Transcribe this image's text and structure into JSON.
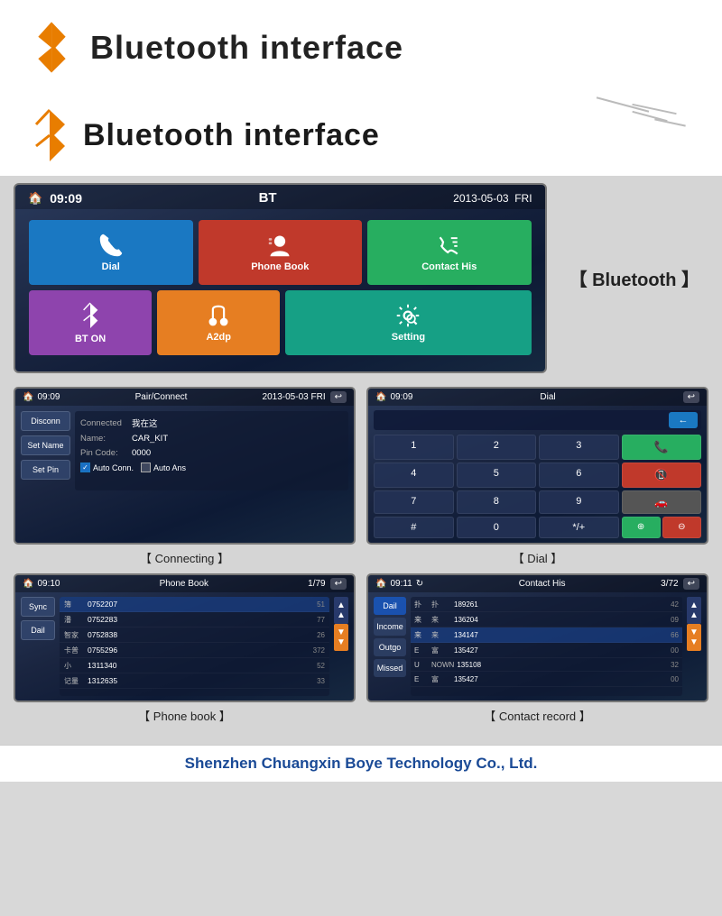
{
  "header": {
    "title": "Bluetooth interface",
    "bt_icon_color": "#e87d00"
  },
  "main_screen": {
    "status": {
      "time": "09:09",
      "center": "BT",
      "date": "2013-05-03",
      "day": "FRI"
    },
    "tiles": [
      {
        "id": "dial",
        "label": "Dial",
        "icon": "📞",
        "color": "#1a78c2"
      },
      {
        "id": "phonebook",
        "label": "Phone Book",
        "icon": "👤",
        "color": "#c0392b"
      },
      {
        "id": "contacthis",
        "label": "Contact His",
        "icon": "📋",
        "color": "#27ae60"
      },
      {
        "id": "bton",
        "label": "BT ON",
        "icon": "🔵",
        "color": "#8e44ad"
      },
      {
        "id": "a2dp",
        "label": "A2dp",
        "icon": "🎧",
        "color": "#e67e22"
      },
      {
        "id": "setting",
        "label": "Setting",
        "icon": "⚙",
        "color": "#16a085"
      }
    ]
  },
  "connecting_screen": {
    "status": {
      "time": "09:09",
      "center": "Pair/Connect",
      "date": "2013-05-03",
      "day": "FRI"
    },
    "buttons": [
      "Disconn",
      "Set Name",
      "Set Pin"
    ],
    "info": {
      "connected_label": "Connected",
      "connected_val": "我在这",
      "name_label": "Name:",
      "name_val": "CAR_KIT",
      "pin_label": "Pin Code:",
      "pin_val": "0000"
    },
    "checkboxes": [
      {
        "label": "Auto Conn.",
        "checked": true
      },
      {
        "label": "Auto Ans",
        "checked": false
      }
    ],
    "caption": "【 Connecting 】"
  },
  "dial_screen": {
    "status": {
      "time": "09:09",
      "center": "Dial"
    },
    "keys": [
      {
        "val": "1",
        "type": "normal"
      },
      {
        "val": "2",
        "type": "normal"
      },
      {
        "val": "3",
        "type": "normal"
      },
      {
        "val": "←",
        "type": "backspace"
      },
      {
        "val": "4",
        "type": "normal"
      },
      {
        "val": "5",
        "type": "normal"
      },
      {
        "val": "6",
        "type": "normal"
      },
      {
        "val": "📞",
        "type": "call"
      },
      {
        "val": "7",
        "type": "normal"
      },
      {
        "val": "8",
        "type": "normal"
      },
      {
        "val": "9",
        "type": "normal"
      },
      {
        "val": "📵",
        "type": "end"
      },
      {
        "val": "#",
        "type": "normal"
      },
      {
        "val": "0",
        "type": "normal"
      },
      {
        "val": "*/+",
        "type": "normal"
      },
      {
        "val": "🚗",
        "type": "car"
      }
    ],
    "caption": "【 Dial 】"
  },
  "phonebook_screen": {
    "status": {
      "time": "09:10",
      "center": "Phone Book",
      "page": "1/79"
    },
    "buttons": [
      "Sync",
      "Dail"
    ],
    "entries": [
      {
        "name": "簿",
        "number": "0752207",
        "suffix": "51"
      },
      {
        "name": "潘",
        "number": "0752283",
        "suffix": "77"
      },
      {
        "name": "智家",
        "number": "0752838",
        "suffix": "26"
      },
      {
        "name": "卡普",
        "number": "0755296",
        "suffix": "372"
      },
      {
        "name": "小",
        "number": "1311340",
        "suffix": "52"
      },
      {
        "name": "记量",
        "number": "1312635",
        "suffix": "33"
      }
    ],
    "caption": "【 Phone book 】"
  },
  "contact_screen": {
    "status": {
      "time": "09:11",
      "center": "Contact His",
      "page": "3/72"
    },
    "tabs": [
      "Dail",
      "Income",
      "Outgo",
      "Missed"
    ],
    "entries": [
      {
        "icon": "扑",
        "name": "扑",
        "number": "189261",
        "suffix": "42"
      },
      {
        "icon": "来",
        "name": "来",
        "number": "136204",
        "suffix": "09"
      },
      {
        "icon": "来",
        "name": "来",
        "number": "134147",
        "suffix": "66",
        "selected": true
      },
      {
        "icon": "E",
        "name": "富",
        "number": "135427",
        "suffix": "00"
      },
      {
        "icon": "U",
        "name": "NOWN",
        "number": "135108",
        "suffix": "32"
      },
      {
        "icon": "E",
        "name": "富",
        "number": "135427",
        "suffix": "00"
      }
    ],
    "caption": "【 Contact record 】"
  },
  "bluetooth_label": "【 Bluetooth 】",
  "footer": "Shenzhen Chuangxin Boye Technology Co., Ltd."
}
